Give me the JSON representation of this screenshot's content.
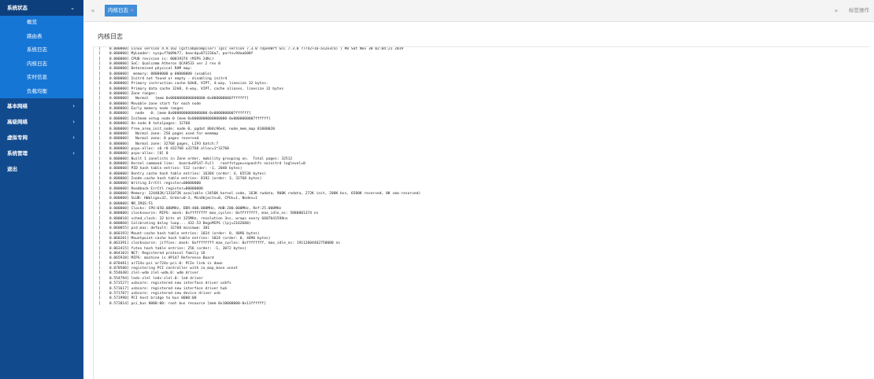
{
  "sidebar": {
    "top": {
      "label": "系统状态",
      "icon": "chevron-down-icon",
      "chevron": "⌄"
    },
    "sub_items": [
      {
        "label": "概览"
      },
      {
        "label": "路由表"
      },
      {
        "label": "系统日志"
      },
      {
        "label": "内核日志"
      },
      {
        "label": "实时信息"
      },
      {
        "label": "负载均衡"
      }
    ],
    "items": [
      {
        "label": "基本网络",
        "chevron": "›"
      },
      {
        "label": "高级网络",
        "chevron": "›"
      },
      {
        "label": "虚拟专网",
        "chevron": "›"
      },
      {
        "label": "系统管理",
        "chevron": "›"
      },
      {
        "label": "退出",
        "chevron": ""
      }
    ]
  },
  "tabbar": {
    "prev": "«",
    "next": "»",
    "tab": {
      "label": "内核日志",
      "close": "×"
    },
    "ops": "标签操作"
  },
  "page": {
    "title": "内核日志"
  },
  "log": [
    "[    0.000000] Linux version 4.9.162 (gitlab@compiler) (gcc version 7.3.0 (OpenWrt GCC 7.3.0 r7742+16-a12e3ca) ) #0 Sat Nov 30 02:04:21 2019",
    "[    0.000000] MyLoader: sysp=f7b09b77, boardp=071236a7, parts=9daa600f",
    "[    0.000000] CPU0 revision is: 00019374 (MIPS 24Kc)",
    "[    0.000000] SoC: Qualcomm Atheros QCA9533 ver 2 rev 0",
    "[    0.000000] Determined physical RAM map:",
    "[    0.000000]  memory: 08000000 @ 00000000 (usable)",
    "[    0.000000] Initrd not found or empty - disabling initrd",
    "[    0.000000] Primary instruction cache 64kB, VIPT, 4-way, linesize 32 bytes.",
    "[    0.000000] Primary data cache 32kB, 4-way, VIPT, cache aliases, linesize 32 bytes",
    "[    0.000000] Zone ranges:",
    "[    0.000000]   Normal   [mem 0x0000000000000000-0x0000000007ffffff]",
    "[    0.000000] Movable zone start for each node",
    "[    0.000000] Early memory node ranges",
    "[    0.000000]   node   0: [mem 0x0000000000000000-0x0000000007ffffff]",
    "[    0.000000] Initmem setup node 0 [mem 0x0000000000000000-0x0000000007ffffff]",
    "[    0.000000] On node 0 totalpages: 32768",
    "[    0.000000] free_area_init_node: node 0, pgdat 804c96e4, node_mem_map 81000020",
    "[    0.000000]   Normal zone: 256 pages used for memmap",
    "[    0.000000]   Normal zone: 0 pages reserved",
    "[    0.000000]   Normal zone: 32768 pages, LIFO batch:7",
    "[    0.000000] pcpu-alloc: s0 r0 d32768 u32768 alloc=1*32768",
    "[    0.000000] pcpu-alloc: [0] 0",
    "[    0.000000] Built 1 zonelists in Zone order, mobility grouping on.  Total pages: 32512",
    "[    0.000000] Kernel command line:  board=AP147-Full   rootfstype=squashfs noinitrd loglevel=0",
    "[    0.000000] PID hash table entries: 512 (order: -1, 2048 bytes)",
    "[    0.000000] Dentry cache hash table entries: 16384 (order: 4, 65536 bytes)",
    "[    0.000000] Inode-cache hash table entries: 8192 (order: 3, 32768 bytes)",
    "[    0.000000] Writing ErrCtl register=00000000",
    "[    0.000000] Readback ErrCtl register=00000000",
    "[    0.000000] Memory: 124482K/131072K available (3456K kernel code, 163K rwdata, 900K rodata, 272K init, 208K bss, 6580K reserved, 0K cma-reserved)",
    "[    0.000000] SLUB: HWalign=32, Order=0-3, MinObjects=0, CPUs=1, Nodes=1",
    "[    0.000000] NR_IRQS:51",
    "[    0.000000] Clocks: CPU:650.000MHz, DDR:400.000MHz, AHB:200.000MHz, Ref:25.000MHz",
    "[    0.000000] clocksource: MIPS: mask: 0xffffffff max_cycles: 0xffffffff, max_idle_ns: 5880801374 ns",
    "[    0.000010] sched_clock: 32 bits at 325MHz, resolution 3ns, wraps every 6607641598ns",
    "[    0.000060] Calibrating delay loop... 432.53 BogoMIPS (lpj=2162688)",
    "[    0.060055] pid_max: default: 32768 minimum: 301",
    "[    0.060193] Mount-cache hash table entries: 1024 (order: 0, 4096 bytes)",
    "[    0.060201] Mountpoint-cache hash table entries: 1024 (order: 0, 4096 bytes)",
    "[    0.063391] clocksource: jiffies: mask: 0xffffffff max_cycles: 0xffffffff, max_idle_ns: 19112604462750000 ns",
    "[    0.063415] futex hash table entries: 256 (order: -1, 3072 bytes)",
    "[    0.064103] NET: Registered protocol family 16",
    "[    0.065938] MIPS: machine is AP147 Reference Board",
    "[    0.070481] ar724x-pci ar724x-pci.0: PCIe link is down",
    "[    0.070500] registering PCI controller with io_map_base unset",
    "[    0.554640] zlel-wdm zlel-wdm.0: wdm driver",
    "[    0.554794] leds-zlel leds-zlel.0: led driver",
    "[    0.571527] usbcore: registered new interface driver usbfs",
    "[    0.571617] usbcore: registered new interface driver hub",
    "[    0.571707] usbcore: registered new device driver usb",
    "[    0.571990] PCI host bridge to bus 0000:00",
    "[    0.572014] pci_bus 0000:00: root bus resource [mem 0x10000000-0x11ffffff]"
  ]
}
